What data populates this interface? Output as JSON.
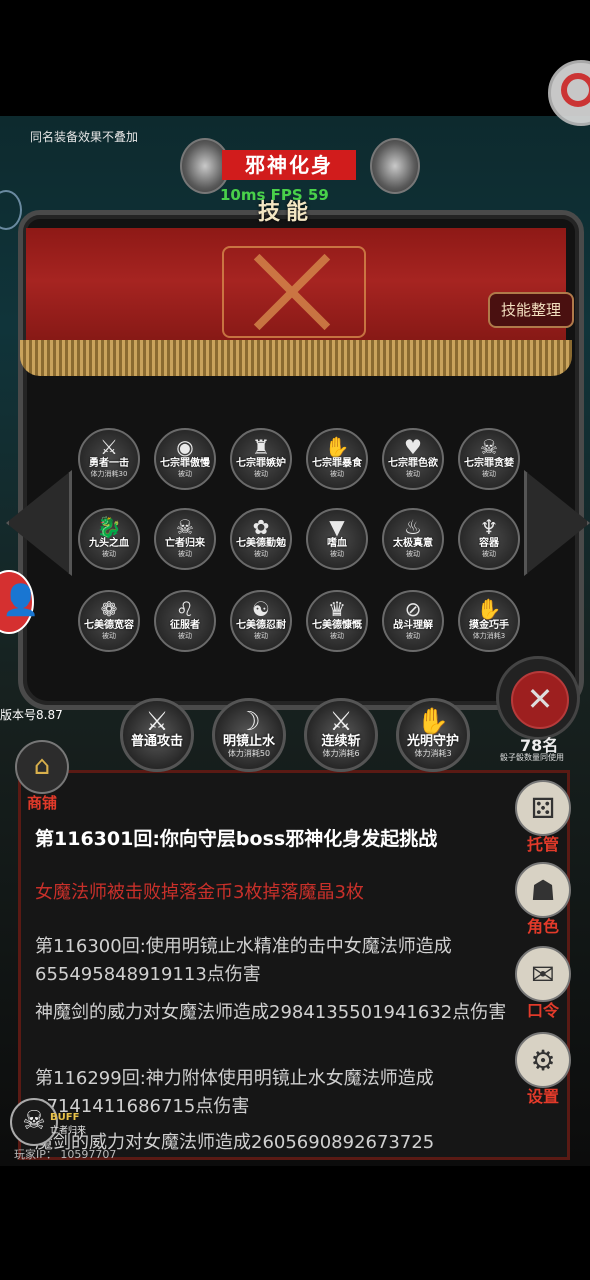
{
  "top_note": "同名装备效果不叠加",
  "boss_name": "邪神化身",
  "net_info": "10ms FPS 59",
  "panel_title": "技能",
  "organize_label": "技能整理",
  "skills": [
    {
      "name": "勇者一击",
      "status": "体力消耗30",
      "icon": "crossed-swords-icon",
      "glyph": "⚔"
    },
    {
      "name": "七宗罪傲慢",
      "status": "被动",
      "icon": "eye-icon",
      "glyph": "◉"
    },
    {
      "name": "七宗罪嫉妒",
      "status": "被动",
      "icon": "mask-icon",
      "glyph": "♜"
    },
    {
      "name": "七宗罪暴食",
      "status": "被动",
      "icon": "claw-icon",
      "glyph": "✋"
    },
    {
      "name": "七宗罪色欲",
      "status": "被动",
      "icon": "heart-chain-icon",
      "glyph": "♥"
    },
    {
      "name": "七宗罪贪婪",
      "status": "被动",
      "icon": "skull-icon",
      "glyph": "☠"
    },
    {
      "name": "九头之血",
      "status": "被动",
      "icon": "hydra-icon",
      "glyph": "🐉"
    },
    {
      "name": "亡者归来",
      "status": "被动",
      "icon": "horned-skull-icon",
      "glyph": "☠"
    },
    {
      "name": "七美德勤勉",
      "status": "被动",
      "icon": "lotus-icon",
      "glyph": "✿"
    },
    {
      "name": "嗜血",
      "status": "被动",
      "icon": "fangs-icon",
      "glyph": "▼"
    },
    {
      "name": "太极真意",
      "status": "被动",
      "icon": "flame-icon",
      "glyph": "♨"
    },
    {
      "name": "容器",
      "status": "被动",
      "icon": "demon-icon",
      "glyph": "♆"
    },
    {
      "name": "七美德宽容",
      "status": "被动",
      "icon": "spiral-icon",
      "glyph": "❁"
    },
    {
      "name": "征服者",
      "status": "被动",
      "icon": "lion-icon",
      "glyph": "♌"
    },
    {
      "name": "七美德忍耐",
      "status": "被动",
      "icon": "swirl-icon",
      "glyph": "☯"
    },
    {
      "name": "七美德慷慨",
      "status": "被动",
      "icon": "crown-icon",
      "glyph": "♛"
    },
    {
      "name": "战斗理解",
      "status": "被动",
      "icon": "sword-circle-icon",
      "glyph": "⊘"
    },
    {
      "name": "摸金巧手",
      "status": "体力消耗3",
      "icon": "hand-icon",
      "glyph": "✋"
    }
  ],
  "version": "版本号8.87",
  "counter": {
    "value": "78名",
    "hint": "骰子骰数量同使用"
  },
  "quick_skills": [
    {
      "name": "普通攻击",
      "status": "",
      "icon": "sword-slash-icon",
      "glyph": "⚔"
    },
    {
      "name": "明镜止水",
      "status": "体力消耗50",
      "icon": "blade-arc-icon",
      "glyph": "☽"
    },
    {
      "name": "连续斩",
      "status": "体力消耗6",
      "icon": "double-swords-icon",
      "glyph": "⚔"
    },
    {
      "name": "光明守护",
      "status": "体力消耗3",
      "icon": "palm-icon",
      "glyph": "✋"
    }
  ],
  "log": [
    "第116301回:你向守层boss邪神化身发起挑战",
    "女魔法师被击败掉落金币3枚掉落魔晶3枚",
    "第116300回:使用明镜止水精准的击中女魔法师造成655495848919113点伤害",
    "神魔剑的威力对女魔法师造成2984135501941632点伤害",
    "第116299回:神力附体使用明镜止水女魔法师造成87141411686715点伤害",
    "魔剑的威力对女魔法师造成2605690892673725"
  ],
  "shop_label": "商铺",
  "menu": {
    "auto": "托管",
    "role": "角色",
    "code": "口令",
    "settings": "设置"
  },
  "buff": {
    "label": "BUFF",
    "sub": "亡者归来"
  },
  "player_ip": "玩家IP： 10597707",
  "close_symbol": "✕"
}
